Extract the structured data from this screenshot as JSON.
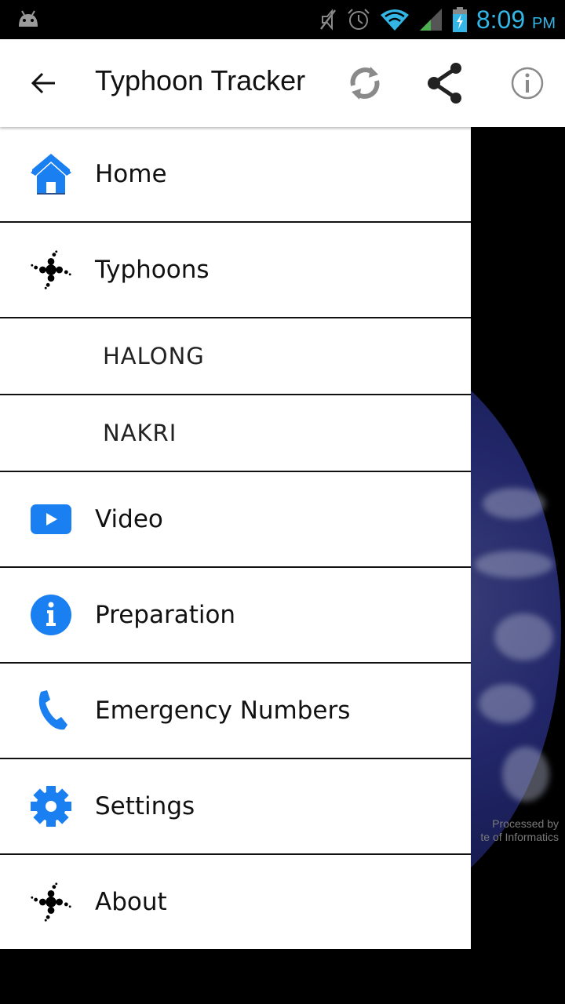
{
  "status_bar": {
    "time": "8:09",
    "ampm": "PM",
    "icons": [
      "android-icon",
      "mute-icon",
      "alarm-icon",
      "wifi-icon",
      "signal-icon",
      "battery-charging-icon"
    ],
    "accent_color": "#33b5e5"
  },
  "app_bar": {
    "title": "Typhoon Tracker",
    "back_icon": "arrow-left-icon",
    "actions": [
      {
        "name": "refresh",
        "icon": "refresh-icon"
      },
      {
        "name": "share",
        "icon": "share-icon"
      },
      {
        "name": "info",
        "icon": "info-icon"
      }
    ]
  },
  "drawer": {
    "items": [
      {
        "label": "Home",
        "icon": "home-icon"
      },
      {
        "label": "Typhoons",
        "icon": "typhoon-icon"
      },
      {
        "label": "HALONG",
        "sub": true
      },
      {
        "label": "NAKRI",
        "sub": true
      },
      {
        "label": "Video",
        "icon": "video-play-icon"
      },
      {
        "label": "Preparation",
        "icon": "info-circle-icon"
      },
      {
        "label": "Emergency Numbers",
        "icon": "phone-icon"
      },
      {
        "label": "Settings",
        "icon": "gear-icon"
      },
      {
        "label": "About",
        "icon": "typhoon-icon"
      }
    ],
    "icon_color": "#1a7ff0"
  },
  "background": {
    "credit_line1": "Processed by",
    "credit_line2": "te of Informatics"
  }
}
